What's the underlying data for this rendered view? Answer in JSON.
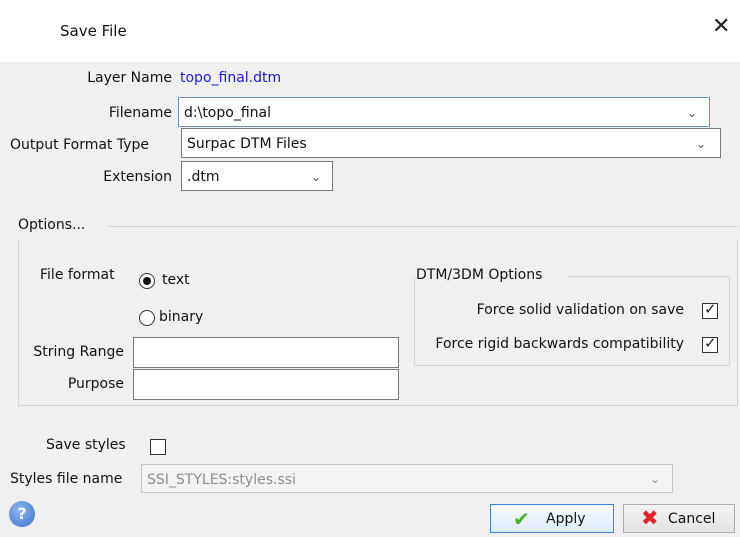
{
  "window": {
    "title": "Save File",
    "close_glyph": "✕"
  },
  "form": {
    "layer_name_label": "Layer Name",
    "layer_name_value": "topo_final.dtm",
    "filename_label": "Filename",
    "filename_value": "d:\\topo_final",
    "output_format_label": "Output Format Type",
    "output_format_value": "Surpac DTM Files",
    "extension_label": "Extension",
    "extension_value": ".dtm",
    "link_color": "#1a1adc"
  },
  "options": {
    "heading": "Options...",
    "file_format_label": "File format",
    "text_label": "text",
    "binary_label": "binary",
    "selected": "text",
    "string_range_label": "String Range",
    "string_range_value": "",
    "purpose_label": "Purpose",
    "purpose_value": "",
    "dtm_group_title": "DTM/3DM Options",
    "force_solid_label": "Force solid validation on save",
    "force_solid_checked": true,
    "force_rigid_label": "Force rigid backwards compatibility",
    "force_rigid_checked": true
  },
  "styles": {
    "save_styles_label": "Save styles",
    "save_styles_checked": false,
    "styles_file_label": "Styles file name",
    "styles_file_value": "SSI_STYLES:styles.ssi"
  },
  "buttons": {
    "apply_label": "Apply",
    "cancel_label": "Cancel",
    "help_glyph": "?",
    "apply_icon_color": "#4caf28",
    "cancel_icon_color": "#e0262b",
    "focus_color": "#3c7fd8"
  },
  "icons": {
    "chevron": "chevron-down-icon",
    "check": "check-icon",
    "apply": "green-check-icon",
    "cancel": "red-x-icon",
    "help": "question-icon"
  }
}
